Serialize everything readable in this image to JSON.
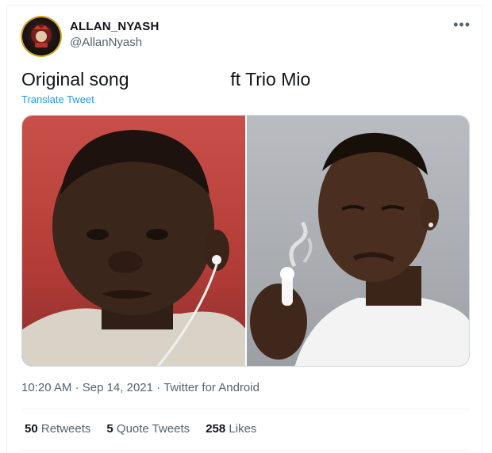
{
  "user": {
    "display_name": "ALLAN_NYASH",
    "handle": "@AllanNyash"
  },
  "more_icon": "more-horizontal-icon",
  "tweet": {
    "text": "Original song                    ft Trio Mio",
    "translate_label": "Translate Tweet",
    "time": "10:20 AM",
    "date": "Sep 14, 2021",
    "source": "Twitter for Android",
    "separator": "·"
  },
  "stats": [
    {
      "count": "50",
      "label": "Retweets"
    },
    {
      "count": "5",
      "label": "Quote Tweets"
    },
    {
      "count": "258",
      "label": "Likes"
    }
  ],
  "colors": {
    "link_blue": "#1d9bf0",
    "secondary_text": "#536471",
    "avatar_ring": "#d7a51c"
  }
}
